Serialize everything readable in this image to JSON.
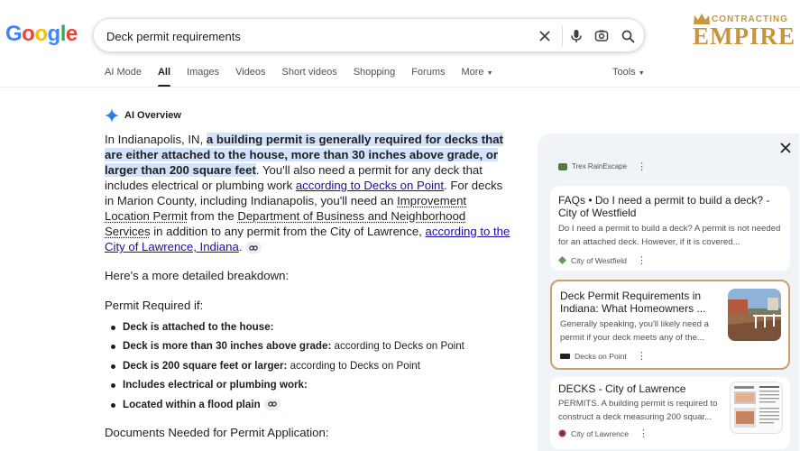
{
  "search": {
    "query": "Deck permit requirements"
  },
  "logo": {
    "text": "Google"
  },
  "brand": {
    "line1": "CONTRACTING",
    "line2": "EMPIRE"
  },
  "tabs": [
    {
      "label": "AI Mode"
    },
    {
      "label": "All"
    },
    {
      "label": "Images"
    },
    {
      "label": "Videos"
    },
    {
      "label": "Short videos"
    },
    {
      "label": "Shopping"
    },
    {
      "label": "Forums"
    },
    {
      "label": "More"
    }
  ],
  "tools_label": "Tools",
  "ai_overview": {
    "label": "AI Overview",
    "p1": {
      "a": "In Indianapolis, IN, ",
      "hl": "a building permit is generally required for decks that are either attached to the house, more than 30 inches above grade, or larger than 200 square feet",
      "b": ". You'll also need a permit for any deck that includes electrical or plumbing work ",
      "link1": "according to Decks on Point",
      "c": ". For decks in Marion County, including Indianapolis, you'll need an ",
      "u1": "Improvement Location Permit",
      "d": " from the ",
      "u2": "Department of Business and Neighborhood Services",
      "e": " in addition to any permit from the City of Lawrence, ",
      "link2": "according to the City of Lawrence, Indiana",
      "f": "."
    },
    "detail": "Here's a more detailed breakdown:",
    "permit_heading": "Permit Required if:",
    "bullets": [
      {
        "bold": "Deck is attached to the house:",
        "rest": ""
      },
      {
        "bold": "Deck is more than 30 inches above grade:",
        "rest": " according to Decks on Point"
      },
      {
        "bold": "Deck is 200 square feet or larger:",
        "rest": " according to Decks on Point"
      },
      {
        "bold": "Includes electrical or plumbing work:",
        "rest": ""
      },
      {
        "bold": "Located within a flood plain",
        "rest": ""
      }
    ],
    "docs_heading": "Documents Needed for Permit Application:"
  },
  "sources": {
    "top_source": "Trex RainEscape",
    "cards": [
      {
        "title": "FAQs • Do I need a permit to build a deck? - City of Westfield",
        "snippet": "Do I need a permit to build a deck? A permit is not needed for an attached deck. However, if it is covered...",
        "source": "City of Westfield"
      },
      {
        "title": "Deck Permit Requirements in Indiana: What Homeowners ...",
        "snippet": "Generally speaking, you'll likely need a permit if your deck meets any of the...",
        "source": "Decks on Point"
      },
      {
        "title": "DECKS - City of Lawrence",
        "snippet": "PERMITS. A building permit is required to construct a deck measuring 200 squar...",
        "source": "City of Lawrence"
      }
    ]
  },
  "colors": {
    "accent": "#1a0dab",
    "highlight": "#d3e3fd",
    "panel": "#f0f4f9",
    "selected_border": "#c8a06a"
  }
}
